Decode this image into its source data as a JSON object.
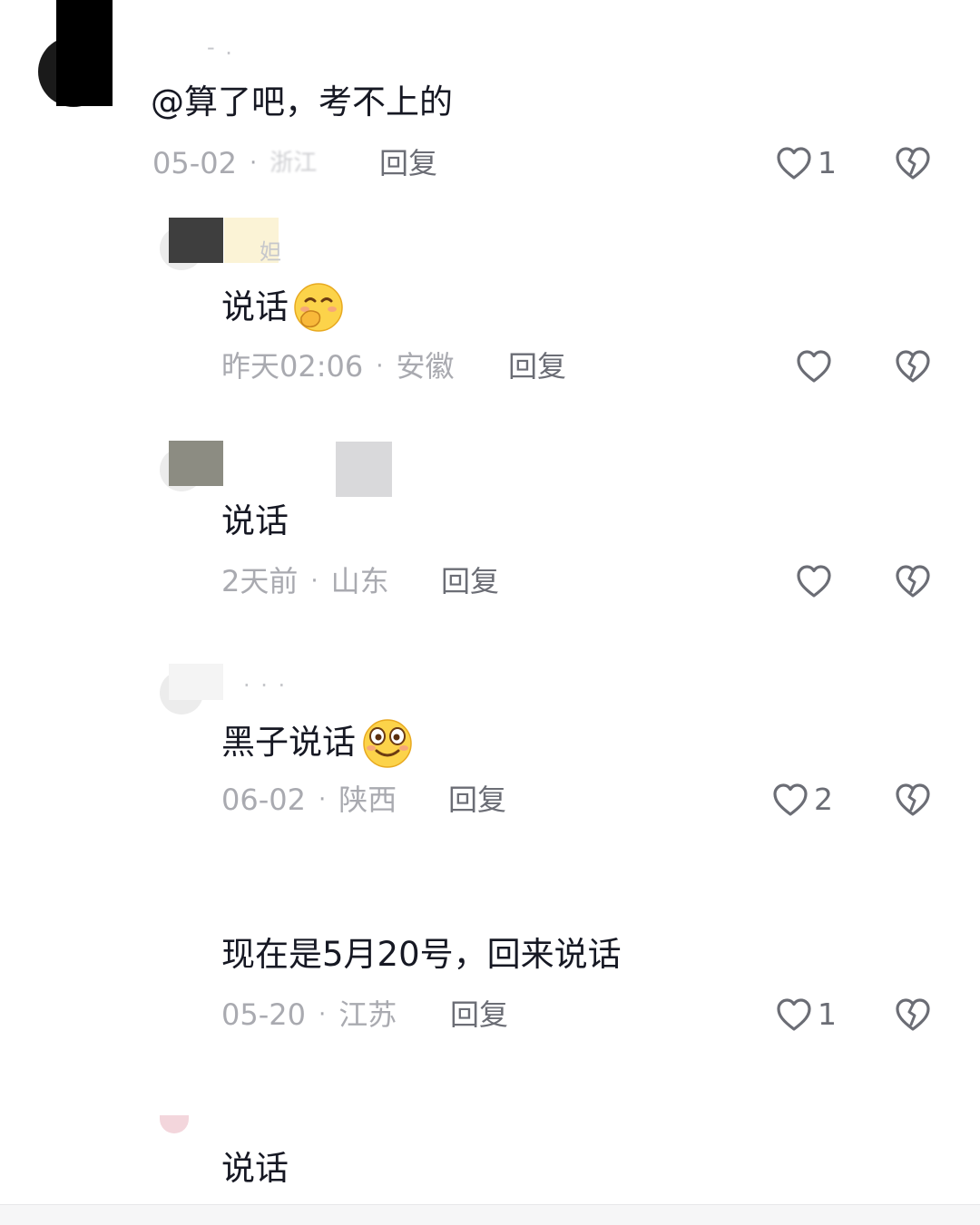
{
  "comments": [
    {
      "text": "@算了吧，考不上的",
      "date": "05-02",
      "location": "浙江",
      "reply": "回复",
      "likes": "1"
    },
    {
      "text": "说话",
      "date": "昨天02:06",
      "location": "安徽",
      "reply": "回复",
      "likes": "",
      "emoji": "smile-cover-mouth-emoji"
    },
    {
      "text": "说话",
      "date": "2天前",
      "location": "山东",
      "reply": "回复",
      "likes": ""
    },
    {
      "text": "黑子说话",
      "date": "06-02",
      "location": "陕西",
      "reply": "回复",
      "likes": "2",
      "emoji": "goofy-grin-emoji"
    },
    {
      "text": "现在是5月20号，回来说话",
      "date": "05-20",
      "location": "江苏",
      "reply": "回复",
      "likes": "1"
    },
    {
      "text": "说话"
    }
  ],
  "colors": {
    "text": "#161823",
    "meta": "#a9aab0",
    "reply": "#6b6d75",
    "icon": "#6b6d75"
  },
  "icons": {
    "like": "heart-outline-icon",
    "dislike": "broken-heart-icon"
  }
}
